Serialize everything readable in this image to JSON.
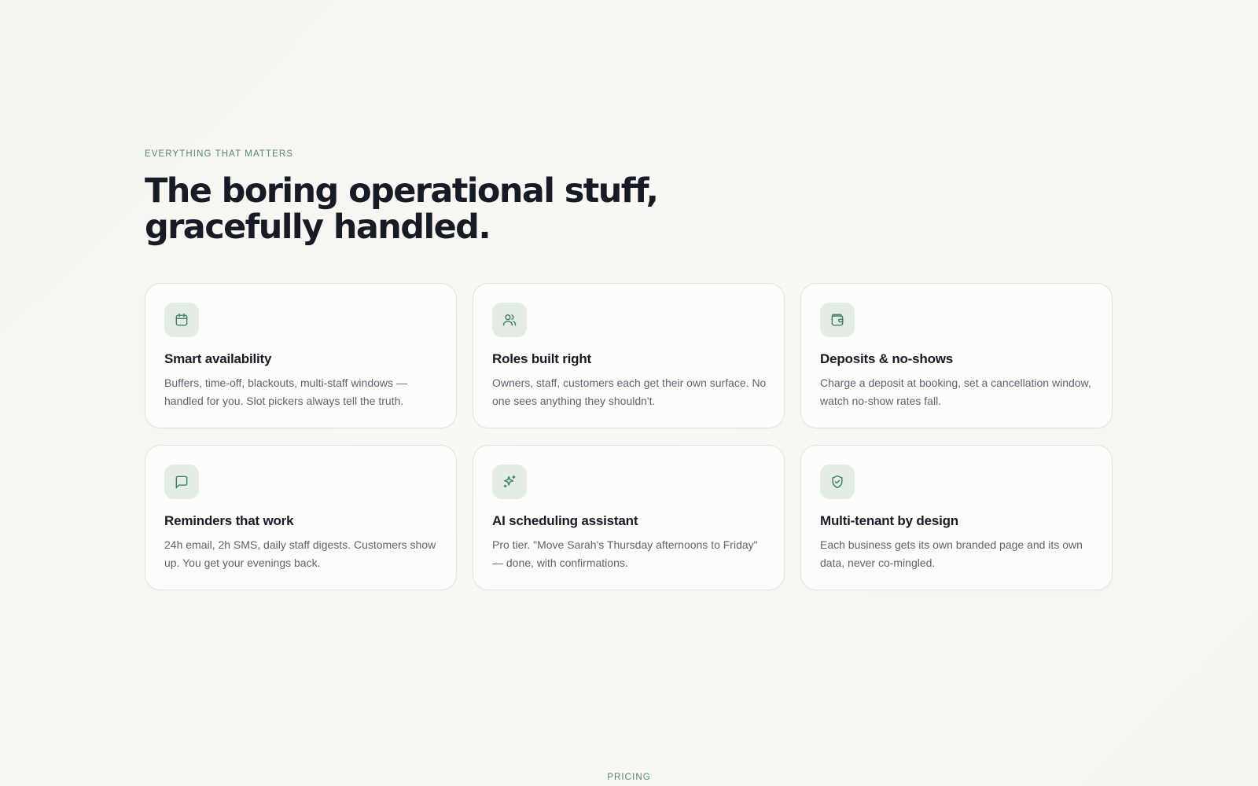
{
  "features_section": {
    "eyebrow": "EVERYTHING THAT MATTERS",
    "headline_line1": "The boring operational stuff,",
    "headline_line2": "gracefully handled.",
    "cards": [
      {
        "icon": "calendar-icon",
        "title": "Smart availability",
        "description": "Buffers, time-off, blackouts, multi-staff windows — handled for you. Slot pickers always tell the truth."
      },
      {
        "icon": "users-icon",
        "title": "Roles built right",
        "description": "Owners, staff, customers each get their own surface. No one sees anything they shouldn't."
      },
      {
        "icon": "wallet-icon",
        "title": "Deposits & no-shows",
        "description": "Charge a deposit at booking, set a cancellation window, watch no-show rates fall."
      },
      {
        "icon": "message-square-icon",
        "title": "Reminders that work",
        "description": "24h email, 2h SMS, daily staff digests. Customers show up. You get your evenings back."
      },
      {
        "icon": "sparkles-icon",
        "title": "AI scheduling assistant",
        "description": "Pro tier. \"Move Sarah's Thursday afternoons to Friday\" — done, with confirmations."
      },
      {
        "icon": "shield-check-icon",
        "title": "Multi-tenant by design",
        "description": "Each business gets its own branded page and its own data, never co-mingled."
      }
    ]
  },
  "pricing_section": {
    "eyebrow": "PRICING"
  },
  "colors": {
    "accent": "#4f8a6b",
    "icon_tile_bg": "#e3ede6",
    "heading": "#161b26",
    "body_text": "#5d6470",
    "background": "#f8f6f1",
    "card_bg": "#fdfcfa"
  }
}
